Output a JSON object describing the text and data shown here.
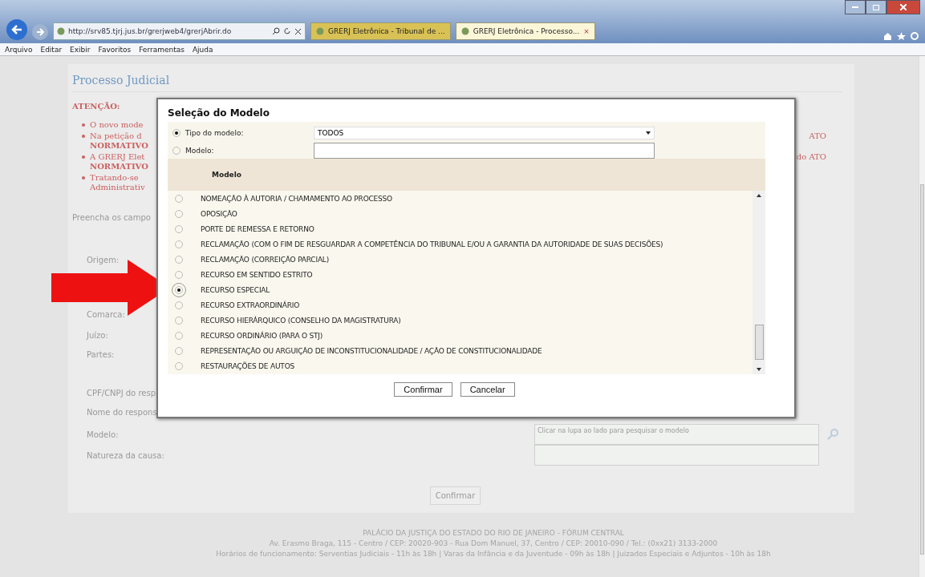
{
  "browser": {
    "url": "http://srv85.tjrj.jus.br/grerjweb4/grerjAbrir.do",
    "tabs": [
      {
        "title": "GRERJ Eletrônica - Tribunal de ...",
        "selected": false
      },
      {
        "title": "GRERJ Eletrônica - Processo...",
        "selected": true,
        "close": "×"
      }
    ],
    "menu": [
      "Arquivo",
      "Editar",
      "Exibir",
      "Favoritos",
      "Ferramentas",
      "Ajuda"
    ]
  },
  "page": {
    "title": "Processo Judicial",
    "attention": "ATENÇÃO:",
    "bullets": [
      {
        "lines": [
          "O novo mode"
        ]
      },
      {
        "lines": [
          "Na petição d",
          "NORMATIVO"
        ],
        "tail": "ATO"
      },
      {
        "lines": [
          "A GRERJ Elet",
          "NORMATIVO"
        ],
        "tail": "do ATO"
      },
      {
        "lines": [
          "Tratando-se",
          "Administrativ"
        ]
      }
    ],
    "intro": "Preencha os campo",
    "form": [
      {
        "kind": "label",
        "label": "Origem:"
      },
      {
        "kind": "label",
        "label": "Comarca:"
      },
      {
        "kind": "label",
        "label": "Juízo:"
      },
      {
        "kind": "label",
        "label": "Partes:"
      },
      {
        "kind": "label",
        "label": "CPF/CNPJ do resp"
      },
      {
        "kind": "label",
        "label": "Nome do respons"
      },
      {
        "kind": "field",
        "label": "Modelo:",
        "placeholder": "Clicar na lupa ao lado para pesquisar o modelo",
        "search": true
      },
      {
        "kind": "field",
        "label": "Natureza da causa:"
      }
    ],
    "submit": "Confirmar",
    "footer": [
      "PALÁCIO DA JUSTIÇA DO ESTADO DO RIO DE JANEIRO - FÓRUM CENTRAL",
      "Av. Erasmo Braga, 115 - Centro / CEP: 20020-903 - Rua Dom Manuel, 37, Centro / CEP: 20010-090 / Tel.: (0xx21) 3133-2000",
      "Horários de funcionamento: Serventias Judiciais - 11h às 18h | Varas da Infância e da Juventude - 09h às 18h | Juizados Especiais e Adjuntos - 10h às 18h"
    ]
  },
  "dialog": {
    "title": "Seleção do Modelo",
    "filters": [
      {
        "label": "Tipo do modelo:",
        "selected": true,
        "kind": "select",
        "value": "TODOS"
      },
      {
        "label": "Modelo:",
        "selected": false,
        "kind": "text"
      }
    ],
    "column": "Modelo",
    "rows": [
      {
        "label": "NOMEAÇÃO À AUTORIA / CHAMAMENTO AO PROCESSO",
        "selected": false
      },
      {
        "label": "OPOSIÇÃO",
        "selected": false
      },
      {
        "label": "PORTE DE REMESSA E RETORNO",
        "selected": false
      },
      {
        "label": "RECLAMAÇÃO (COM O FIM DE RESGUARDAR A COMPETÊNCIA DO TRIBUNAL E/OU A GARANTIA DA AUTORIDADE DE SUAS DECISÕES)",
        "selected": false
      },
      {
        "label": "RECLAMAÇÃO (CORREIÇÃO PARCIAL)",
        "selected": false
      },
      {
        "label": "RECURSO EM SENTIDO ESTRITO",
        "selected": false
      },
      {
        "label": "RECURSO ESPECIAL",
        "selected": true
      },
      {
        "label": "RECURSO EXTRAORDINÁRIO",
        "selected": false
      },
      {
        "label": "RECURSO HIERÁRQUICO (CONSELHO DA MAGISTRATURA)",
        "selected": false
      },
      {
        "label": "RECURSO ORDINÁRIO (PARA O STJ)",
        "selected": false
      },
      {
        "label": "REPRESENTAÇÃO OU ARGUIÇÃO DE INCONSTITUCIONALIDADE / AÇÃO DE CONSTITUCIONALIDADE",
        "selected": false
      },
      {
        "label": "RESTAURAÇÕES DE AUTOS",
        "selected": false
      }
    ],
    "buttons": [
      "Confirmar",
      "Cancelar"
    ]
  }
}
